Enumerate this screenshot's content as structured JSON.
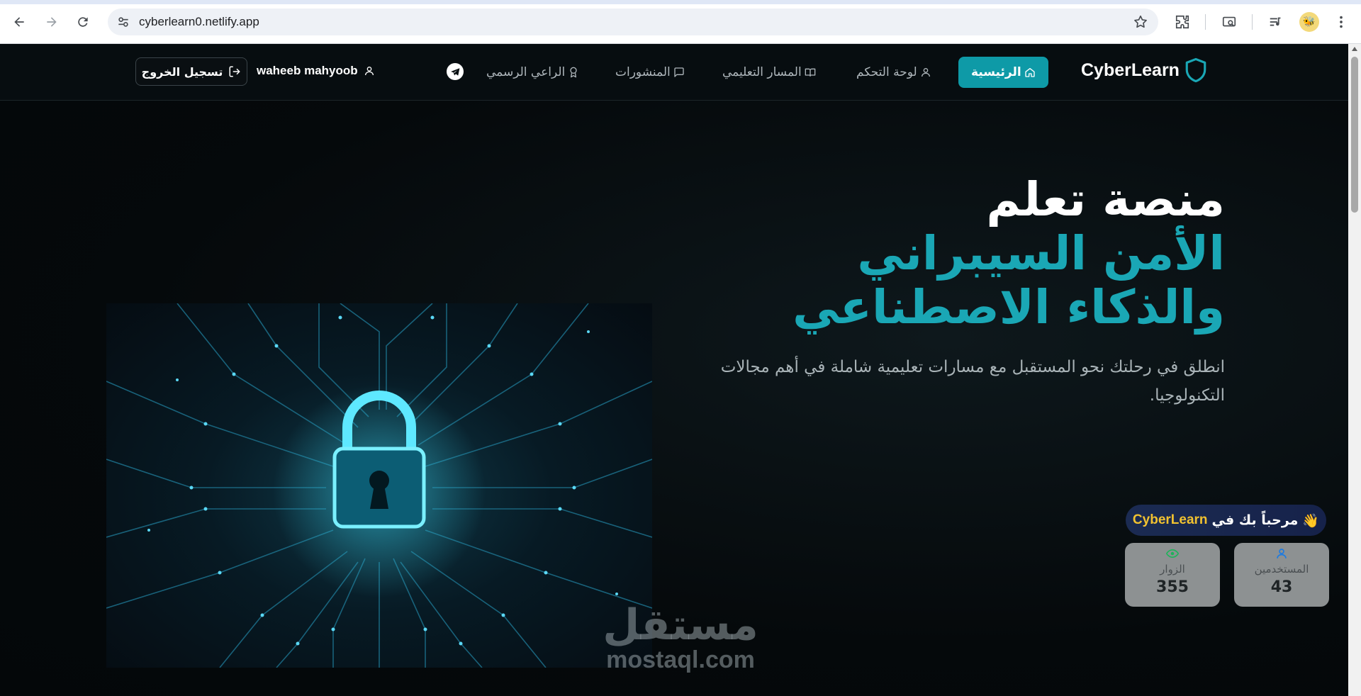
{
  "browser": {
    "url": "cyberlearn0.netlify.app"
  },
  "header": {
    "brand": "CyberLearn",
    "nav": [
      {
        "label": "الرئيسية",
        "icon": "home-icon",
        "active": true
      },
      {
        "label": "لوحة التحكم",
        "icon": "user-icon",
        "active": false
      },
      {
        "label": "المسار التعليمي",
        "icon": "book-icon",
        "active": false
      },
      {
        "label": "المنشورات",
        "icon": "message-icon",
        "active": false
      },
      {
        "label": "الراعي الرسمي",
        "icon": "award-icon",
        "active": false
      }
    ],
    "user_name": "waheeb mahyoob",
    "logout_label": "تسجيل الخروج"
  },
  "hero": {
    "title_line1": "منصة تعلم",
    "title_line2": "الأمن السيبراني والذكاء الاصطناعي",
    "subtitle": "انطلق في رحلتك نحو المستقبل مع مسارات تعليمية شاملة في أهم مجالات التكنولوجيا.",
    "image_icon": "padlock-circuit-icon"
  },
  "welcome": {
    "text": "مرحباً بك في",
    "brand": "CyberLearn",
    "emoji": "👋"
  },
  "stats": [
    {
      "label": "المستخدمين",
      "value": "43",
      "icon": "user-icon",
      "color": "#1e7be0"
    },
    {
      "label": "الزوار",
      "value": "355",
      "icon": "eye-icon",
      "color": "#1fb35a"
    }
  ],
  "watermark": {
    "arabic": "مستقل",
    "latin": "mostaql.com"
  },
  "colors": {
    "accent": "#0e9aa7",
    "title_accent": "#1aa7b5",
    "welcome_brand": "#f2c230"
  }
}
